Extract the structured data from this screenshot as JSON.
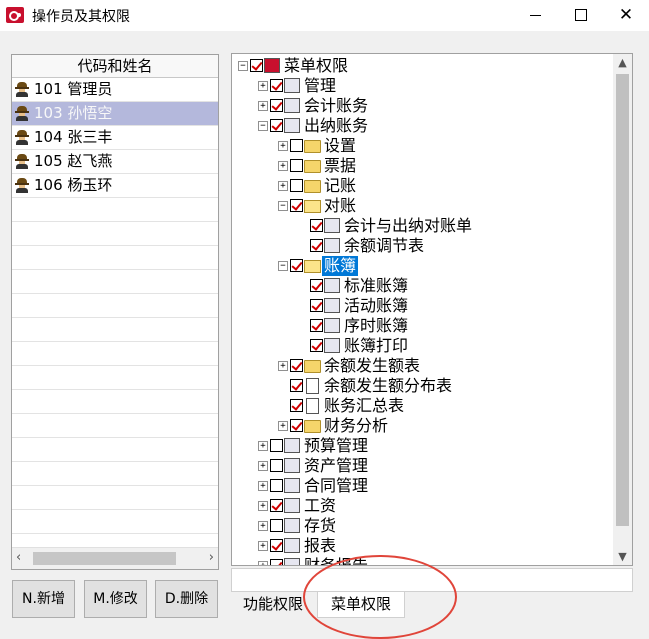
{
  "window": {
    "title": "操作员及其权限",
    "controls": [
      "minimize",
      "maximize",
      "close"
    ]
  },
  "operators": {
    "header": "代码和姓名",
    "rows": [
      {
        "text": "101 管理员",
        "selected": false
      },
      {
        "text": "103 孙悟空",
        "selected": true
      },
      {
        "text": "104 张三丰",
        "selected": false
      },
      {
        "text": "105 赵飞燕",
        "selected": false
      },
      {
        "text": "106 杨玉环",
        "selected": false
      }
    ]
  },
  "buttons": {
    "new": "N.新增",
    "edit": "M.修改",
    "delete": "D.删除"
  },
  "tree": {
    "root": "菜单权限",
    "nodes": [
      {
        "label": "管理",
        "checked": true
      },
      {
        "label": "会计账务",
        "checked": true
      },
      {
        "label": "出纳账务",
        "checked": true
      },
      {
        "label": "设置",
        "checked": false
      },
      {
        "label": "票据",
        "checked": false
      },
      {
        "label": "记账",
        "checked": false
      },
      {
        "label": "对账",
        "checked": true
      },
      {
        "label": "会计与出纳对账单",
        "checked": true
      },
      {
        "label": "余额调节表",
        "checked": true
      },
      {
        "label": "账簿",
        "checked": true
      },
      {
        "label": "标准账簿",
        "checked": true
      },
      {
        "label": "活动账簿",
        "checked": true
      },
      {
        "label": "序时账簿",
        "checked": true
      },
      {
        "label": "账簿打印",
        "checked": true
      },
      {
        "label": "余额发生额表",
        "checked": true
      },
      {
        "label": "余额发生额分布表",
        "checked": true
      },
      {
        "label": "账务汇总表",
        "checked": true
      },
      {
        "label": "财务分析",
        "checked": true
      },
      {
        "label": "预算管理",
        "checked": false
      },
      {
        "label": "资产管理",
        "checked": false
      },
      {
        "label": "合同管理",
        "checked": false
      },
      {
        "label": "工资",
        "checked": true
      },
      {
        "label": "存货",
        "checked": false
      },
      {
        "label": "报表",
        "checked": true
      },
      {
        "label": "财务报告",
        "checked": true
      }
    ]
  },
  "tabs": {
    "func": "功能权限",
    "menu": "菜单权限"
  },
  "colors": {
    "selection": "#b4b8dc",
    "highlight": "#0078d7",
    "check": "#d00000",
    "annotation": "#e0453a"
  }
}
